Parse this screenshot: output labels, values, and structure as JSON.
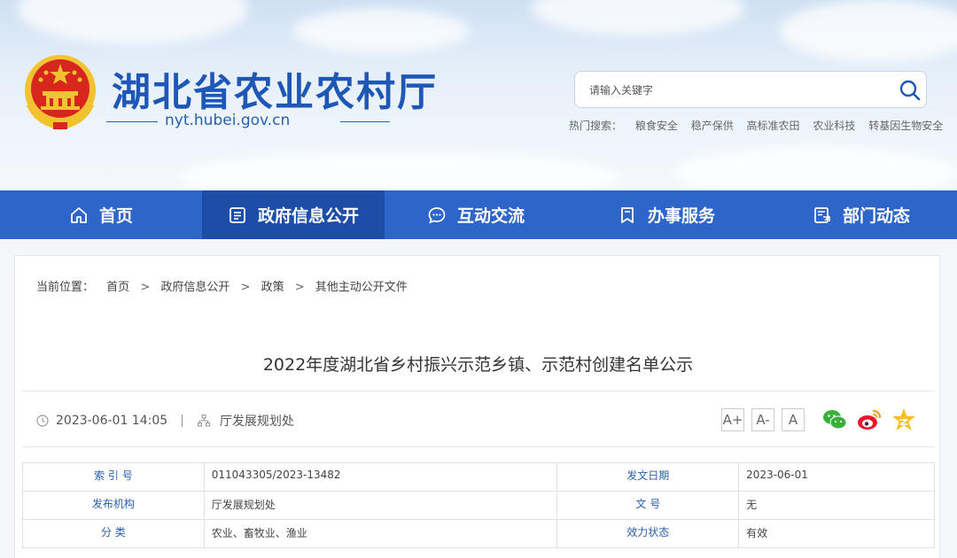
{
  "header": {
    "site_title": "湖北省农业农村厅",
    "site_domain": "nyt.hubei.gov.cn",
    "search_placeholder": "请输入关键字",
    "hot_label": "热门搜索：",
    "hot_items": [
      "粮食安全",
      "稳产保供",
      "高标准农田",
      "农业科技",
      "转基因生物安全"
    ]
  },
  "nav": {
    "items": [
      {
        "label": "首页",
        "icon": "home-icon"
      },
      {
        "label": "政府信息公开",
        "icon": "document-list-icon"
      },
      {
        "label": "互动交流",
        "icon": "chat-icon"
      },
      {
        "label": "办事服务",
        "icon": "bookmark-icon"
      },
      {
        "label": "部门动态",
        "icon": "news-icon"
      }
    ],
    "active_index": 1
  },
  "breadcrumb": {
    "label": "当前位置：",
    "items": [
      "首页",
      "政府信息公开",
      "政策",
      "其他主动公开文件"
    ],
    "separator": ">"
  },
  "article": {
    "title": "2022年度湖北省乡村振兴示范乡镇、示范村创建名单公示",
    "datetime": "2023-06-01 14:05",
    "meta_separator": "|",
    "publisher": "厅发展规划处"
  },
  "font_buttons": [
    "A+",
    "A-",
    "A"
  ],
  "share_icons": [
    "wechat-icon",
    "weibo-icon",
    "qzone-icon"
  ],
  "info_table": [
    [
      {
        "label": "索 引 号",
        "value": "011043305/2023-13482"
      },
      {
        "label": "发文日期",
        "value": "2023-06-01"
      }
    ],
    [
      {
        "label": "发布机构",
        "value": "厅发展规划处"
      },
      {
        "label": "文 号",
        "value": "无"
      }
    ],
    [
      {
        "label": "分 类",
        "value": "农业、畜牧业、渔业"
      },
      {
        "label": "效力状态",
        "value": "有效"
      }
    ]
  ],
  "colors": {
    "brand_blue": "#2d66c8",
    "nav_active": "#1c4ea8",
    "title_blue": "#1e57b5",
    "emblem_red": "#d7261e",
    "emblem_gold": "#f2c230"
  }
}
